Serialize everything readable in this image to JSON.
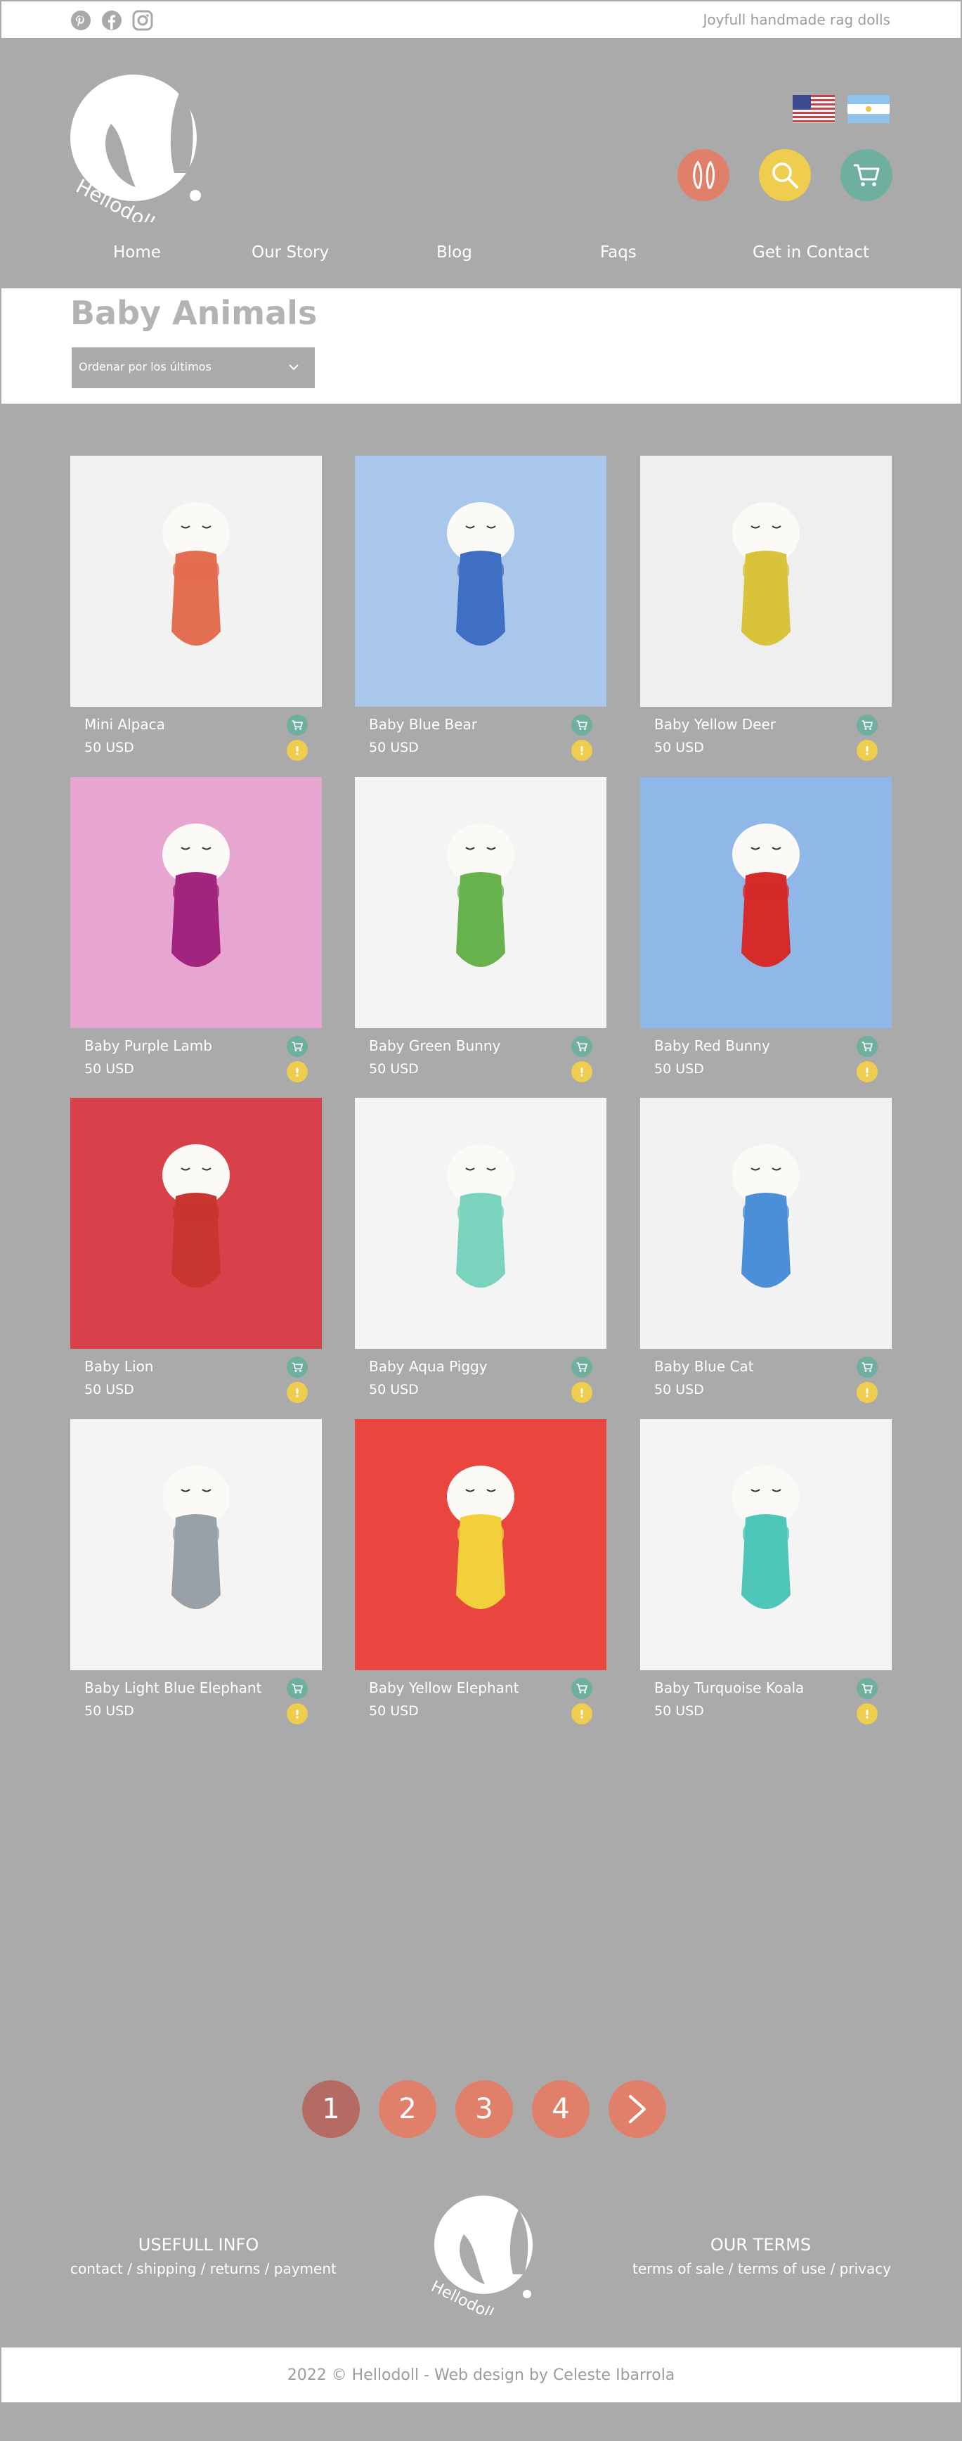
{
  "topbar": {
    "tagline": "Joyfull handmade rag dolls",
    "social_icons": [
      "pinterest-icon",
      "facebook-icon",
      "instagram-icon"
    ]
  },
  "header": {
    "logo_text": "Hellodoll",
    "flags": [
      "us-flag",
      "argentina-flag"
    ],
    "buttons": [
      "bunny-icon",
      "search-icon",
      "cart-icon"
    ],
    "nav": [
      "Home",
      "Our Story",
      "Blog",
      "Faqs",
      "Get in Contact"
    ]
  },
  "main": {
    "title": "Baby Animals",
    "sort_label": "Ordenar por los últimos"
  },
  "products": [
    {
      "name": "Mini Alpaca",
      "price": "50 USD",
      "bg": "#f2f2f2"
    },
    {
      "name": "Baby Blue Bear",
      "price": "50 USD",
      "bg": "#a9c7ea"
    },
    {
      "name": "Baby Yellow Deer",
      "price": "50 USD",
      "bg": "#efefef"
    },
    {
      "name": "Baby Purple Lamb",
      "price": "50 USD",
      "bg": "#e6a6cf"
    },
    {
      "name": "Baby Green Bunny",
      "price": "50 USD",
      "bg": "#f4f4f4"
    },
    {
      "name": "Baby Red Bunny",
      "price": "50 USD",
      "bg": "#8fb8e8"
    },
    {
      "name": "Baby Lion",
      "price": "50 USD",
      "bg": "#d8404a"
    },
    {
      "name": "Baby Aqua Piggy",
      "price": "50 USD",
      "bg": "#f4f4f4"
    },
    {
      "name": "Baby Blue Cat",
      "price": "50 USD",
      "bg": "#f2f2f2"
    },
    {
      "name": "Baby Light Blue Elephant",
      "price": "50 USD",
      "bg": "#f4f4f4"
    },
    {
      "name": "Baby Yellow Elephant",
      "price": "50 USD",
      "bg": "#e8463e"
    },
    {
      "name": "Baby Turquoise Koala",
      "price": "50 USD",
      "bg": "#f4f4f4"
    }
  ],
  "pagination": {
    "pages": [
      "1",
      "2",
      "3",
      "4"
    ],
    "next": "›"
  },
  "footer": {
    "info_title": "USEFULL INFO",
    "info_links": "contact / shipping / returns / payment",
    "terms_title": "OUR TERMS",
    "terms_links": "terms of sale / terms of use / privacy",
    "logo_text": "Hellodoll"
  },
  "copyright": "2022 © Hellodoll - Web design by Celeste Ibarrola",
  "colors": {
    "bg": "#aaaaaa",
    "coral": "#e0806a",
    "yellow": "#efcd4f",
    "teal": "#6eaf9e",
    "active_page": "#b36b63"
  }
}
